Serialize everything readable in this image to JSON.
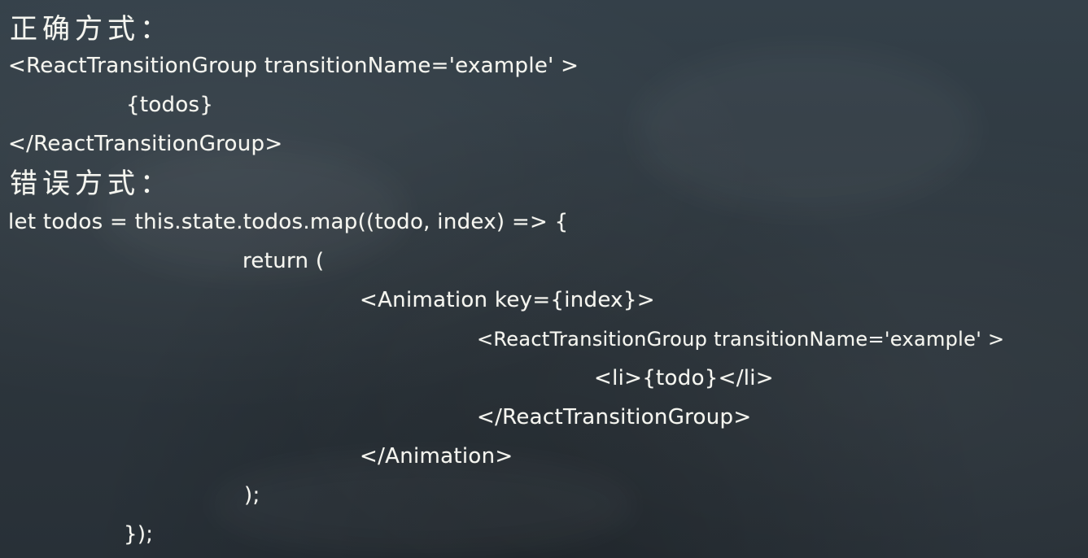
{
  "chalkboard": {
    "heading_correct": "正确方式：",
    "correct_code": [
      "<ReactTransitionGroup transitionName='example' >",
      "{todos}",
      "</ReactTransitionGroup>"
    ],
    "heading_wrong": "错误方式：",
    "wrong_code": [
      "let todos = this.state.todos.map((todo, index) => {",
      "return (",
      "<Animation key={index}>",
      "<ReactTransitionGroup transitionName='example' >",
      "<li>{todo}</li>",
      "</ReactTransitionGroup>",
      "</Animation>",
      ");",
      "});"
    ]
  }
}
